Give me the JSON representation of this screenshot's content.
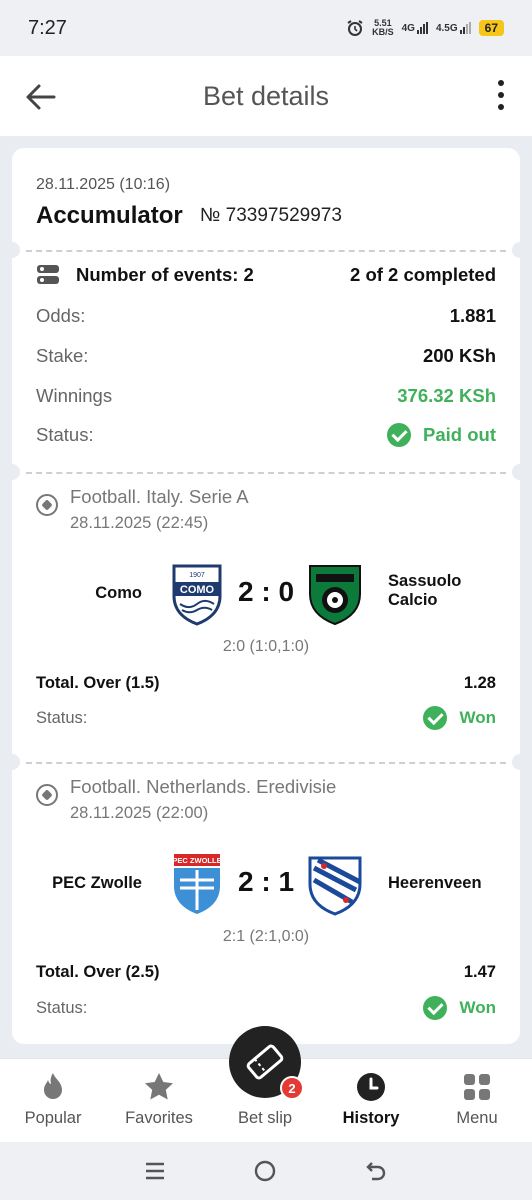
{
  "status_bar": {
    "time": "7:27",
    "speed_value": "5.51",
    "speed_unit": "KB/S",
    "net1": "4G",
    "net2": "4.5G",
    "battery": "67"
  },
  "header": {
    "title": "Bet details"
  },
  "bet": {
    "date": "28.11.2025 (10:16)",
    "type": "Accumulator",
    "number": "№ 73397529973",
    "events_label": "Number of events: 2",
    "completed": "2 of 2 completed",
    "odds_label": "Odds:",
    "odds_value": "1.881",
    "stake_label": "Stake:",
    "stake_value": "200 KSh",
    "winnings_label": "Winnings",
    "winnings_value": "376.32 KSh",
    "status_label": "Status:",
    "status_value": "Paid out"
  },
  "events": [
    {
      "league": "Football. Italy. Serie A",
      "date": "28.11.2025 (22:45)",
      "home": "Como",
      "away_line1": "Sassuolo",
      "away_line2": "Calcio",
      "score": "2 : 0",
      "sub_score": "2:0 (1:0,1:0)",
      "market": "Total. Over (1.5)",
      "odds": "1.28",
      "status_label": "Status:",
      "status": "Won",
      "home_logo_text": "COMO",
      "home_logo_year": "1907"
    },
    {
      "league": "Football. Netherlands. Eredivisie",
      "date": "28.11.2025 (22:00)",
      "home": "PEC Zwolle",
      "away_line1": "Heerenveen",
      "away_line2": "",
      "score": "2 : 1",
      "sub_score": "2:1 (2:1,0:0)",
      "market": "Total. Over (2.5)",
      "odds": "1.47",
      "status_label": "Status:",
      "status": "Won",
      "home_logo_text": "PEC ZWOLLE"
    }
  ],
  "nav": {
    "popular": "Popular",
    "favorites": "Favorites",
    "betslip": "Bet slip",
    "betslip_count": "2",
    "history": "History",
    "menu": "Menu"
  },
  "colors": {
    "green": "#3fb15a",
    "badge": "#e53935",
    "fab": "#222222"
  }
}
